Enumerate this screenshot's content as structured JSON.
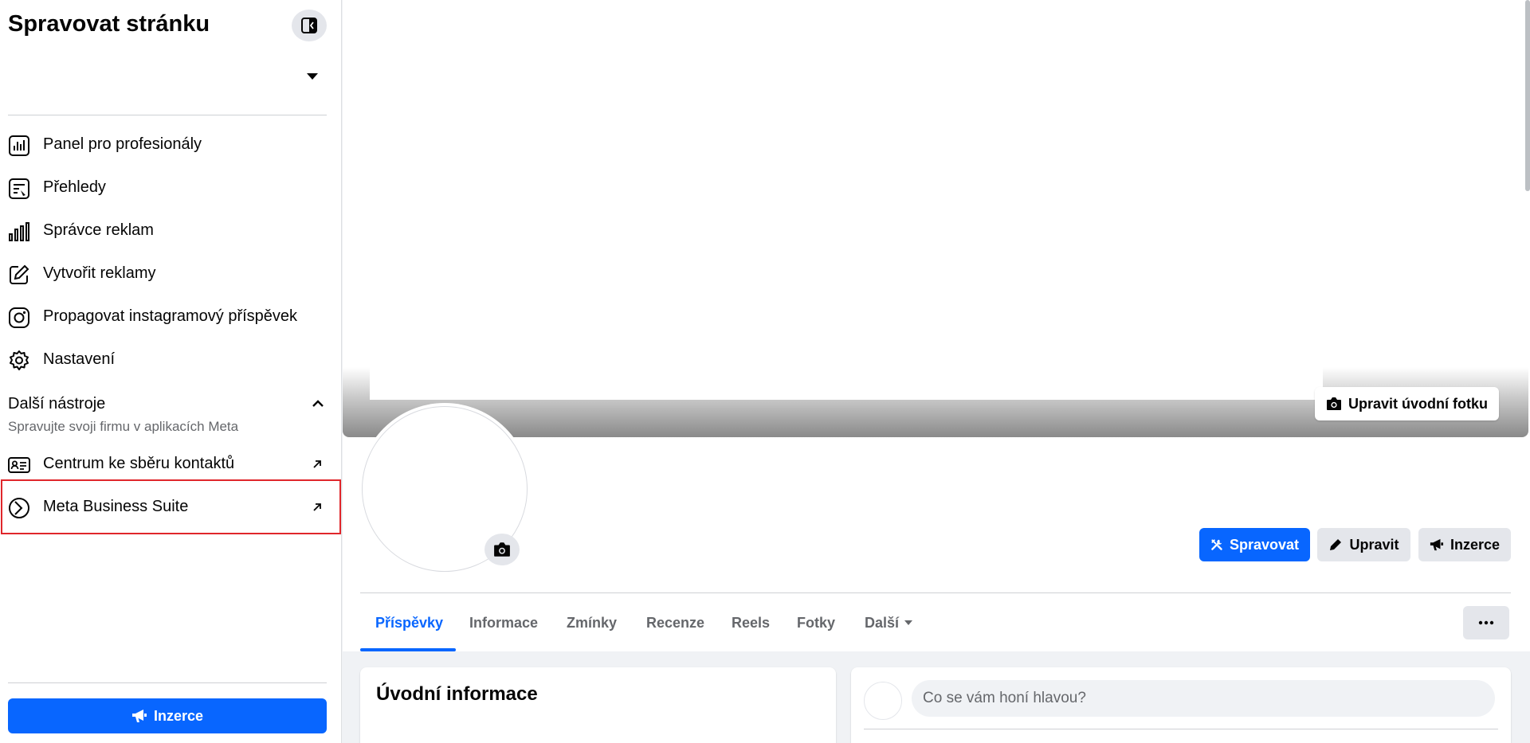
{
  "sidebar": {
    "title": "Spravovat stránku",
    "items": [
      {
        "label": "Panel pro profesionály",
        "icon": "dashboard-icon"
      },
      {
        "label": "Přehledy",
        "icon": "insights-icon"
      },
      {
        "label": "Správce reklam",
        "icon": "bar-chart-icon"
      },
      {
        "label": "Vytvořit reklamy",
        "icon": "pencil-square-icon"
      },
      {
        "label": "Propagovat instagramový příspěvek",
        "icon": "instagram-icon"
      },
      {
        "label": "Nastavení",
        "icon": "gear-icon"
      }
    ],
    "more_tools": {
      "title": "Další nástroje",
      "subtitle": "Spravujte svoji firmu v aplikacích Meta",
      "items": [
        {
          "label": "Centrum ke sběru kontaktů",
          "icon": "contact-card-icon"
        },
        {
          "label": "Meta Business Suite",
          "icon": "meta-business-suite-icon"
        }
      ]
    },
    "ads_button": "Inzerce"
  },
  "cover": {
    "edit_button": "Upravit úvodní fotku"
  },
  "actions": {
    "manage": "Spravovat",
    "edit": "Upravit",
    "ads": "Inzerce"
  },
  "tabs": [
    {
      "label": "Příspěvky",
      "active": true
    },
    {
      "label": "Informace",
      "active": false
    },
    {
      "label": "Zmínky",
      "active": false
    },
    {
      "label": "Recenze",
      "active": false
    },
    {
      "label": "Reels",
      "active": false
    },
    {
      "label": "Fotky",
      "active": false
    },
    {
      "label": "Další",
      "active": false
    }
  ],
  "intro": {
    "title": "Úvodní informace"
  },
  "composer": {
    "placeholder": "Co se vám honí hlavou?"
  },
  "colors": {
    "brand_blue": "#0866ff",
    "highlight_red": "#e0262b",
    "secondary_button": "#e4e6eb"
  }
}
